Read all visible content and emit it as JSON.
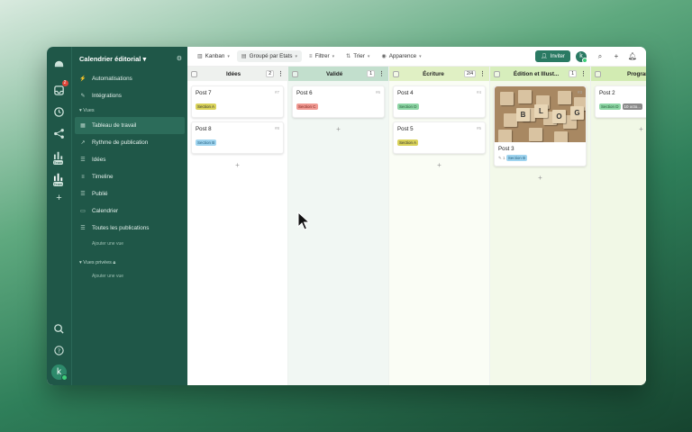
{
  "app": {
    "title": "Calendrier éditorial"
  },
  "rail": {
    "badge": "2",
    "tag1": "Team",
    "tag2": "Team",
    "avatar": "k"
  },
  "sidebar": {
    "items_top": [
      {
        "label": "Automatisations",
        "icon": "lightning-icon"
      },
      {
        "label": "Intégrations",
        "icon": "plug-icon"
      }
    ],
    "views_section": "Vues",
    "views": [
      {
        "label": "Tableau de travail",
        "icon": "board-icon",
        "active": true
      },
      {
        "label": "Rythme de publication",
        "icon": "chart-icon"
      },
      {
        "label": "Idées",
        "icon": "list-icon"
      },
      {
        "label": "Timeline",
        "icon": "timeline-icon"
      },
      {
        "label": "Publié",
        "icon": "list-icon"
      },
      {
        "label": "Calendrier",
        "icon": "calendar-icon"
      },
      {
        "label": "Toutes les publications",
        "icon": "list-icon"
      }
    ],
    "add_view": "Ajouter une vue",
    "private_section": "Vues privées",
    "add_private": "Ajouter une vue"
  },
  "toolbar": {
    "kanban": "Kanban",
    "group": "Groupé par Etats",
    "filter": "Filtrer",
    "sort": "Trier",
    "appearance": "Apparence",
    "invite": "Inviter",
    "avatar": "k"
  },
  "columns": [
    {
      "name": "Idées",
      "count": "2",
      "color": "#eef1ee",
      "bg": "#ffffff",
      "cards": [
        {
          "title": "Post 7",
          "num": "#7",
          "tags": [
            {
              "text": "Section A",
              "bg": "#d9d25a",
              "fg": "#333"
            }
          ]
        },
        {
          "title": "Post 8",
          "num": "#8",
          "tags": [
            {
              "text": "Section B",
              "bg": "#9fd4ef",
              "fg": "#1d5a7a"
            }
          ]
        }
      ]
    },
    {
      "name": "Validé",
      "count": "1",
      "color": "#c2dfcd",
      "bg": "#f1f7f3",
      "cards": [
        {
          "title": "Post 6",
          "num": "#6",
          "tags": [
            {
              "text": "Section C",
              "bg": "#f09a93",
              "fg": "#7a1f18"
            }
          ]
        }
      ]
    },
    {
      "name": "Écriture",
      "count": "2/4",
      "color": "#e0f0c4",
      "bg": "#fafdf5",
      "cards": [
        {
          "title": "Post 4",
          "num": "#4",
          "tags": [
            {
              "text": "Section D",
              "bg": "#8fd6a6",
              "fg": "#1f5a34"
            }
          ]
        },
        {
          "title": "Post 5",
          "num": "#5",
          "tags": [
            {
              "text": "Section A",
              "bg": "#d9d25a",
              "fg": "#333"
            }
          ]
        }
      ]
    },
    {
      "name": "Édition et Illust...",
      "count": "1",
      "color": "#d7eebc",
      "bg": "#f3f9ea",
      "cards": [
        {
          "title": "Post 3",
          "num": "#3",
          "image": true,
          "meta": "1",
          "tags": [
            {
              "text": "Section B",
              "bg": "#9fd4ef",
              "fg": "#1d5a7a"
            }
          ]
        }
      ]
    },
    {
      "name": "Programmé",
      "count": "",
      "color": "#d2ebb2",
      "bg": "#f1f8e6",
      "cards": [
        {
          "title": "Post 2",
          "num": "",
          "tags": [
            {
              "text": "Section D",
              "bg": "#8fd6a6",
              "fg": "#1f5a34"
            },
            {
              "text": "10 octo...",
              "bg": "#8a8a8a",
              "fg": "#fff"
            }
          ]
        }
      ]
    }
  ],
  "image_letters": [
    "B",
    "L",
    "O",
    "G"
  ],
  "add_symbol": "+"
}
